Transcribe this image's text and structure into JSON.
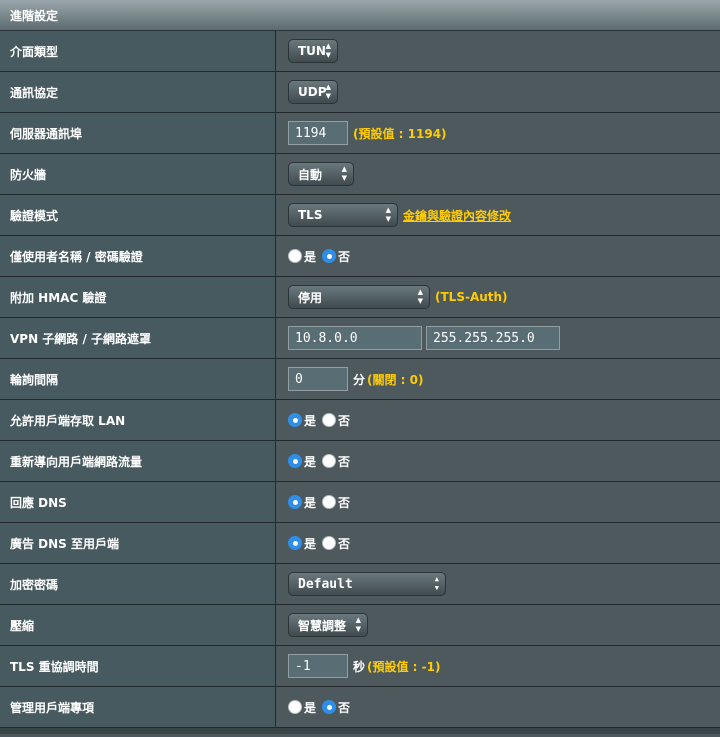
{
  "section_title": "進階設定",
  "rows": {
    "interface_type": {
      "label": "介面類型",
      "value": "TUN"
    },
    "protocol": {
      "label": "通訊協定",
      "value": "UDP"
    },
    "server_port": {
      "label": "伺服器通訊埠",
      "value": "1194",
      "hint": "(預設值 : 1194)"
    },
    "firewall": {
      "label": "防火牆",
      "value": "自動"
    },
    "auth_mode": {
      "label": "驗證模式",
      "value": "TLS",
      "link": "金鑰與驗證內容修改"
    },
    "username_auth": {
      "label": "僅使用者名稱 / 密碼驗證",
      "yes": "是",
      "no": "否",
      "selected": "no"
    },
    "hmac": {
      "label": "附加 HMAC 驗證",
      "value": "停用",
      "hint": "(TLS-Auth)"
    },
    "vpn_subnet": {
      "label": "VPN 子網路 / 子網路遮罩",
      "subnet": "10.8.0.0",
      "mask": "255.255.255.0"
    },
    "poll_interval": {
      "label": "輪詢間隔",
      "value": "0",
      "unit": "分",
      "hint": "(關閉 : 0)"
    },
    "allow_lan": {
      "label": "允許用戶端存取 LAN",
      "yes": "是",
      "no": "否",
      "selected": "yes"
    },
    "redirect": {
      "label": "重新導向用戶端網路流量",
      "yes": "是",
      "no": "否",
      "selected": "yes"
    },
    "respond_dns": {
      "label": "回應 DNS",
      "yes": "是",
      "no": "否",
      "selected": "yes"
    },
    "advertise_dns": {
      "label": "廣告 DNS 至用戶端",
      "yes": "是",
      "no": "否",
      "selected": "yes"
    },
    "cipher": {
      "label": "加密密碼",
      "value": "Default"
    },
    "compression": {
      "label": "壓縮",
      "value": "智慧調整"
    },
    "tls_reneg": {
      "label": "TLS 重協調時間",
      "value": "-1",
      "unit": "秒",
      "hint": "(預設值 : -1)"
    },
    "client_specific": {
      "label": "管理用戶端專項",
      "yes": "是",
      "no": "否",
      "selected": "no"
    }
  }
}
